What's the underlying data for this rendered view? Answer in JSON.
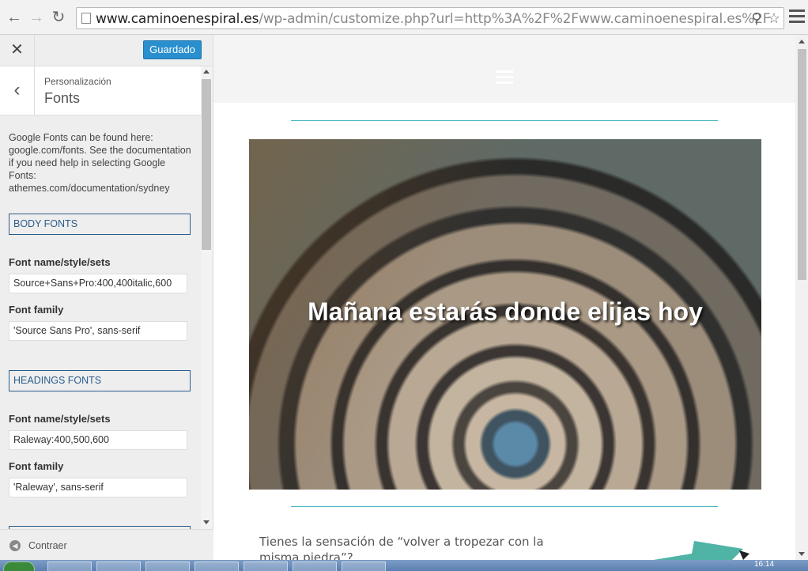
{
  "browser": {
    "url_host": "www.caminoenespiral.es",
    "url_path": "/wp-admin/customize.php?url=http%3A%2F%2Fwww.caminoenespiral.es%2F"
  },
  "sidebar": {
    "save_label": "Guardado",
    "breadcrumb": "Personalización",
    "section_title": "Fonts",
    "description": "Google Fonts can be found here: google.com/fonts. See the documentation if you need help in selecting Google Fonts: athemes.com/documentation/sydney",
    "groups": [
      {
        "heading": "BODY FONTS",
        "fields": [
          {
            "label": "Font name/style/sets",
            "value": "Source+Sans+Pro:400,400italic,600"
          },
          {
            "label": "Font family",
            "value": "'Source Sans Pro', sans-serif"
          }
        ]
      },
      {
        "heading": "HEADINGS FONTS",
        "fields": [
          {
            "label": "Font name/style/sets",
            "value": "Raleway:400,500,600"
          },
          {
            "label": "Font family",
            "value": "'Raleway', sans-serif"
          }
        ]
      }
    ],
    "collapse_label": "Contraer"
  },
  "preview": {
    "hero_title": "Mañana estarás donde elijas hoy",
    "body_text": "Tienes la sensación de “volver a tropezar con la misma piedra”?"
  },
  "taskbar": {
    "clock": "16:14"
  },
  "colors": {
    "accent": "#2a8fcf",
    "rule": "#47b8c4",
    "group_border": "#2b5d8c"
  }
}
